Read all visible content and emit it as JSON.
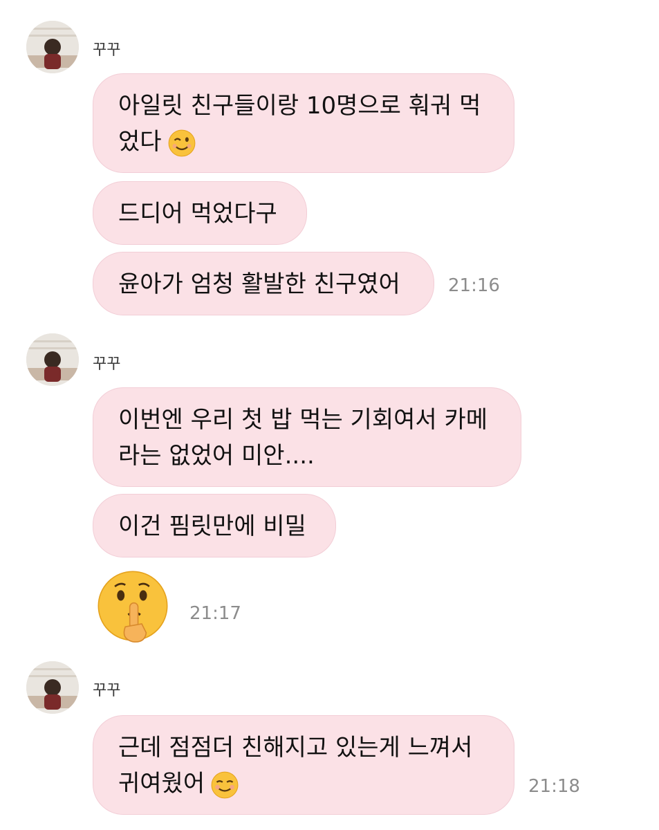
{
  "groups": [
    {
      "sender": "꾸꾸",
      "messages": [
        {
          "line1": "아일릿 친구들이랑 10명으로 훠궈 먹",
          "line2": "었다",
          "emoji": "winking-face"
        },
        {
          "line1": "드디어 먹었다구"
        },
        {
          "line1": "윤아가 엄청 활발한 친구였어"
        }
      ],
      "time": "21:16"
    },
    {
      "sender": "꾸꾸",
      "messages": [
        {
          "line1": "이번엔 우리 첫 밥 먹는 기회여서 카메",
          "line2": "라는 없었어 미안...."
        },
        {
          "line1": "이건 핌릿만에 비밀"
        }
      ],
      "sticker": "shushing-face",
      "time": "21:17"
    },
    {
      "sender": "꾸꾸",
      "messages": [
        {
          "line1": "근데 점점더 친해지고 있는게 느껴서",
          "line2": "귀여웠어",
          "emoji": "smiling-face"
        }
      ],
      "time": "21:18"
    }
  ],
  "colors": {
    "bubble": "#fbe1e6",
    "bubble_border": "#f2cdd6",
    "time": "#8c8c8c"
  }
}
